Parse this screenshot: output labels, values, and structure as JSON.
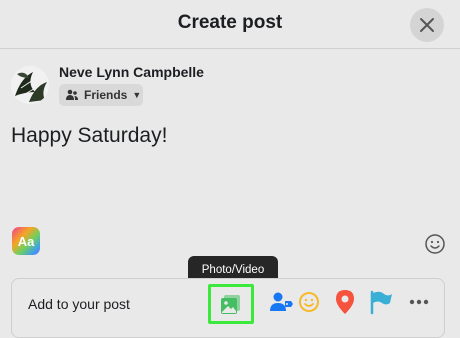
{
  "header": {
    "title": "Create post"
  },
  "user": {
    "name": "Neve Lynn Campbelle"
  },
  "audience": {
    "label": "Friends"
  },
  "post": {
    "text": "Happy Saturday!"
  },
  "text_style_button": {
    "label": "Aa"
  },
  "tooltip": {
    "text": "Photo/Video"
  },
  "add_bar": {
    "label": "Add to your post",
    "icons": [
      "photo-video-icon",
      "tag-people-icon",
      "feeling-icon",
      "check-in-icon",
      "event-flag-icon",
      "more-icon"
    ]
  },
  "colors": {
    "background": "#e9e9e9",
    "highlight": "#3be93b",
    "photo_green": "#45bd62",
    "tag_blue": "#1877f2",
    "feeling_yellow": "#f7b928",
    "checkin_red": "#f5533d",
    "flag_teal": "#39afd5"
  }
}
